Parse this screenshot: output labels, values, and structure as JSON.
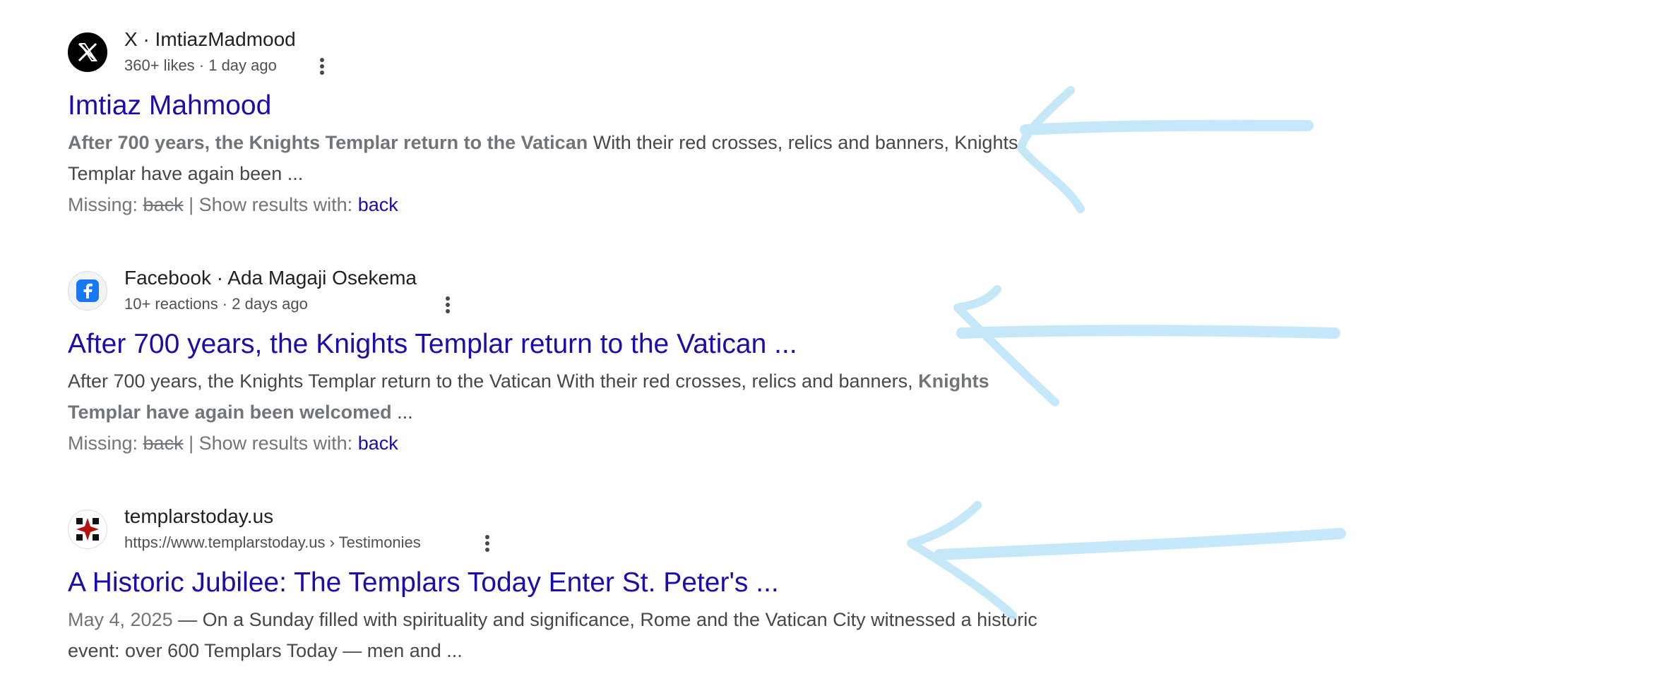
{
  "results": [
    {
      "source_name": "X · ImtiazMadmood",
      "meta": "360+ likes · 1 day ago",
      "title": "Imtiaz Mahmood",
      "snippet_bold": "After 700 years, the Knights Templar return to the Vatican",
      "snippet_rest": " With their red crosses, relics and banners, Knights Templar have again been ...",
      "missing_label": "Missing: ",
      "missing_term": "back",
      "show_label": " | Show results with: ",
      "show_term": "back",
      "icon": "x-logo-icon"
    },
    {
      "source_name": "Facebook · Ada Magaji Osekema",
      "meta": "10+ reactions · 2 days ago",
      "title": "After 700 years, the Knights Templar return to the Vatican ...",
      "snippet_plain": "After 700 years, the Knights Templar return to the Vatican With their red crosses, relics and banners, ",
      "snippet_bold": "Knights Templar have again been welcomed",
      "snippet_tail": " ...",
      "missing_label": "Missing: ",
      "missing_term": "back",
      "show_label": " | Show results with: ",
      "show_term": "back",
      "icon": "facebook-logo-icon"
    },
    {
      "source_name": "templarstoday.us",
      "meta": "https://www.templarstoday.us › Testimonies",
      "title": "A Historic Jubilee: The Templars Today Enter St. Peter's ...",
      "date": "May 4, 2025",
      "snippet_rest": " — On a Sunday filled with spirituality and significance, Rome and the Vatican City witnessed a historic event: over 600 Templars Today — men and ...",
      "icon": "templar-cross-icon"
    }
  ],
  "colors": {
    "link": "#1a0dab",
    "annotation_arrow": "#bfe6f9",
    "text": "#474747"
  }
}
